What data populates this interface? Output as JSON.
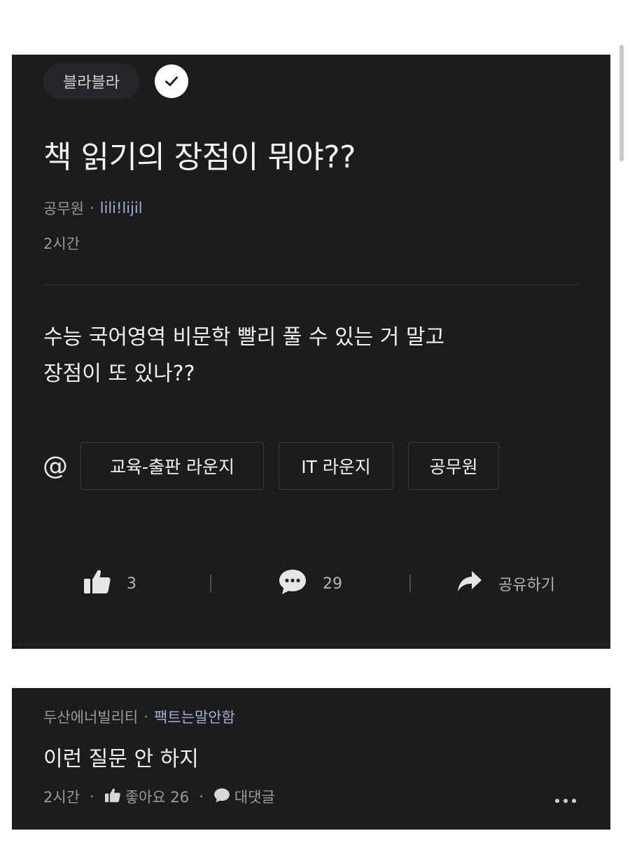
{
  "post": {
    "topic": "블라블라",
    "title": "책 읽기의 장점이 뭐야??",
    "author_company": "공무원",
    "author_nick": "lili!lijil",
    "separator": "·",
    "time": "2시간",
    "body_lines": [
      "수능 국어영역 비문학 빨리 풀 수 있는 거 말고",
      "장점이 또 있나??"
    ],
    "mention_symbol": "@",
    "tags": [
      "교육-출판 라운지",
      "IT 라운지",
      "공무원"
    ],
    "actions": {
      "like_count": "3",
      "comment_count": "29",
      "share_label": "공유하기"
    }
  },
  "comment": {
    "author_company": "두산에너빌리티",
    "author_nick": "팩트는말안함",
    "separator": "·",
    "text": "이런 질문 안 하지",
    "time": "2시간",
    "like_label": "좋아요 26",
    "reply_label": "대댓글"
  },
  "icons": {
    "check": "check-icon",
    "like": "thumbs-up-icon",
    "comment": "speech-bubble-icon",
    "share": "share-arrow-icon",
    "more": "more-horizontal-icon"
  },
  "colors": {
    "card_bg": "#1c1c1e",
    "nick_accent": "#a3aed0",
    "muted_text": "#9a9a9a"
  }
}
